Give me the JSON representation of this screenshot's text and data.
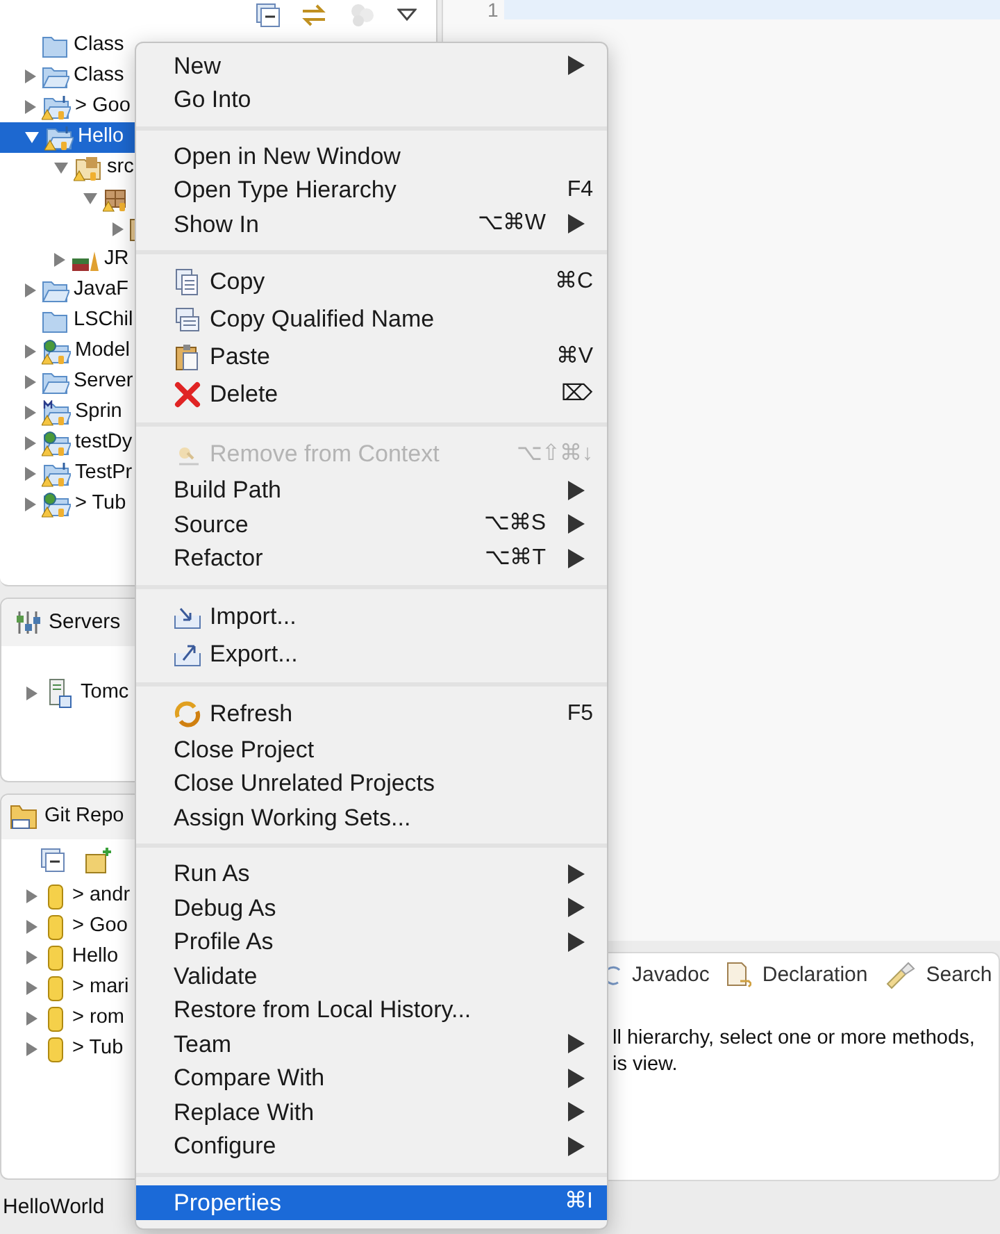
{
  "explorer": {
    "tree": [
      {
        "label": "Class",
        "kind": "folder",
        "selected": false
      },
      {
        "label": "Class",
        "kind": "folder-open",
        "expanded": false,
        "selected": false
      },
      {
        "label": "> Goo",
        "kind": "project",
        "expanded": false,
        "selected": false
      },
      {
        "label": "Hello",
        "kind": "project",
        "expanded": true,
        "selected": true,
        "children": [
          {
            "label": "src",
            "kind": "src",
            "expanded": true,
            "selected": false,
            "children": [
              {
                "kind": "package",
                "expanded": true,
                "selected": false,
                "children": [
                  {
                    "kind": "class",
                    "expanded": false,
                    "selected": false
                  }
                ]
              }
            ]
          },
          {
            "label": "JR",
            "kind": "library",
            "expanded": false,
            "selected": false
          }
        ]
      },
      {
        "label": "JavaF",
        "kind": "folder-open",
        "expanded": false,
        "selected": false
      },
      {
        "label": "LSChil",
        "kind": "folder",
        "selected": false
      },
      {
        "label": "Model",
        "kind": "globe-project",
        "expanded": false,
        "selected": false
      },
      {
        "label": "Server",
        "kind": "folder-open",
        "expanded": false,
        "selected": false
      },
      {
        "label": "Sprin",
        "kind": "maven-project",
        "expanded": false,
        "selected": false
      },
      {
        "label": "testDy",
        "kind": "globe-project",
        "expanded": false,
        "selected": false
      },
      {
        "label": "TestPr",
        "kind": "project",
        "expanded": false,
        "selected": false
      },
      {
        "label": "> Tub",
        "kind": "globe-project",
        "expanded": false,
        "selected": false
      }
    ]
  },
  "servers": {
    "title": "Servers",
    "items": [
      {
        "label": "Tomc",
        "expanded": false,
        "selected": false
      }
    ]
  },
  "git": {
    "title": "Git Repo",
    "items": [
      {
        "label": "> andr",
        "expanded": false,
        "selected": false
      },
      {
        "label": "> Goo",
        "expanded": false,
        "selected": false
      },
      {
        "label": "Hello",
        "expanded": false,
        "selected": false
      },
      {
        "label": "> mari",
        "expanded": false,
        "selected": false
      },
      {
        "label": "> rom",
        "expanded": false,
        "selected": false
      },
      {
        "label": "> Tub",
        "expanded": false,
        "selected": false
      }
    ]
  },
  "editor": {
    "line_numbers": [
      "1"
    ]
  },
  "bottom_panel": {
    "tabs": [
      {
        "label": "Javadoc",
        "kind": "at"
      },
      {
        "label": "Declaration",
        "kind": "declaration"
      },
      {
        "label": "Search",
        "kind": "search"
      }
    ],
    "message": [
      "ll hierarchy, select one or more methods,",
      "is view."
    ]
  },
  "status_bar": {
    "text": "HelloWorld"
  },
  "context_menu": {
    "groups": [
      {
        "items": [
          {
            "label": "New",
            "submenu": true,
            "disabled": false,
            "selected": false
          },
          {
            "label": "Go Into",
            "submenu": false,
            "disabled": false,
            "selected": false
          }
        ]
      },
      {
        "items": [
          {
            "label": "Open in New Window",
            "submenu": false,
            "disabled": false,
            "selected": false
          },
          {
            "label": "Open Type Hierarchy",
            "shortcut": "F4",
            "submenu": false,
            "disabled": false,
            "selected": false
          },
          {
            "label": "Show In",
            "shortcut": "⌥⌘W",
            "submenu": true,
            "disabled": false,
            "selected": false
          }
        ]
      },
      {
        "items": [
          {
            "label": "Copy",
            "kind": "copy",
            "shortcut": "⌘C",
            "submenu": false,
            "disabled": false,
            "selected": false
          },
          {
            "label": "Copy Qualified Name",
            "kind": "copy-name",
            "submenu": false,
            "disabled": false,
            "selected": false
          },
          {
            "label": "Paste",
            "kind": "paste",
            "shortcut": "⌘V",
            "submenu": false,
            "disabled": false,
            "selected": false
          },
          {
            "label": "Delete",
            "kind": "delete",
            "shortcut": "⌦",
            "submenu": false,
            "disabled": false,
            "selected": false
          }
        ]
      },
      {
        "items": [
          {
            "label": "Remove from Context",
            "kind": "remove-context",
            "shortcut": "⌥⇧⌘↓",
            "submenu": false,
            "disabled": true,
            "selected": false
          },
          {
            "label": "Build Path",
            "submenu": true,
            "disabled": false,
            "selected": false
          },
          {
            "label": "Source",
            "shortcut": "⌥⌘S",
            "submenu": true,
            "disabled": false,
            "selected": false
          },
          {
            "label": "Refactor",
            "shortcut": "⌥⌘T",
            "submenu": true,
            "disabled": false,
            "selected": false
          }
        ]
      },
      {
        "items": [
          {
            "label": "Import...",
            "kind": "import",
            "submenu": false,
            "disabled": false,
            "selected": false
          },
          {
            "label": "Export...",
            "kind": "export",
            "submenu": false,
            "disabled": false,
            "selected": false
          }
        ]
      },
      {
        "items": [
          {
            "label": "Refresh",
            "kind": "refresh",
            "shortcut": "F5",
            "submenu": false,
            "disabled": false,
            "selected": false
          },
          {
            "label": "Close Project",
            "submenu": false,
            "disabled": false,
            "selected": false
          },
          {
            "label": "Close Unrelated Projects",
            "submenu": false,
            "disabled": false,
            "selected": false
          },
          {
            "label": "Assign Working Sets...",
            "submenu": false,
            "disabled": false,
            "selected": false
          }
        ]
      },
      {
        "items": [
          {
            "label": "Run As",
            "submenu": true,
            "disabled": false,
            "selected": false
          },
          {
            "label": "Debug As",
            "submenu": true,
            "disabled": false,
            "selected": false
          },
          {
            "label": "Profile As",
            "submenu": true,
            "disabled": false,
            "selected": false
          },
          {
            "label": "Validate",
            "submenu": false,
            "disabled": false,
            "selected": false
          },
          {
            "label": "Restore from Local History...",
            "submenu": false,
            "disabled": false,
            "selected": false
          },
          {
            "label": "Team",
            "submenu": true,
            "disabled": false,
            "selected": false
          },
          {
            "label": "Compare With",
            "submenu": true,
            "disabled": false,
            "selected": false
          },
          {
            "label": "Replace With",
            "submenu": true,
            "disabled": false,
            "selected": false
          },
          {
            "label": "Configure",
            "submenu": true,
            "disabled": false,
            "selected": false
          }
        ]
      },
      {
        "items": [
          {
            "label": "Properties",
            "shortcut": "⌘I",
            "submenu": false,
            "disabled": false,
            "selected": true
          }
        ]
      }
    ]
  }
}
